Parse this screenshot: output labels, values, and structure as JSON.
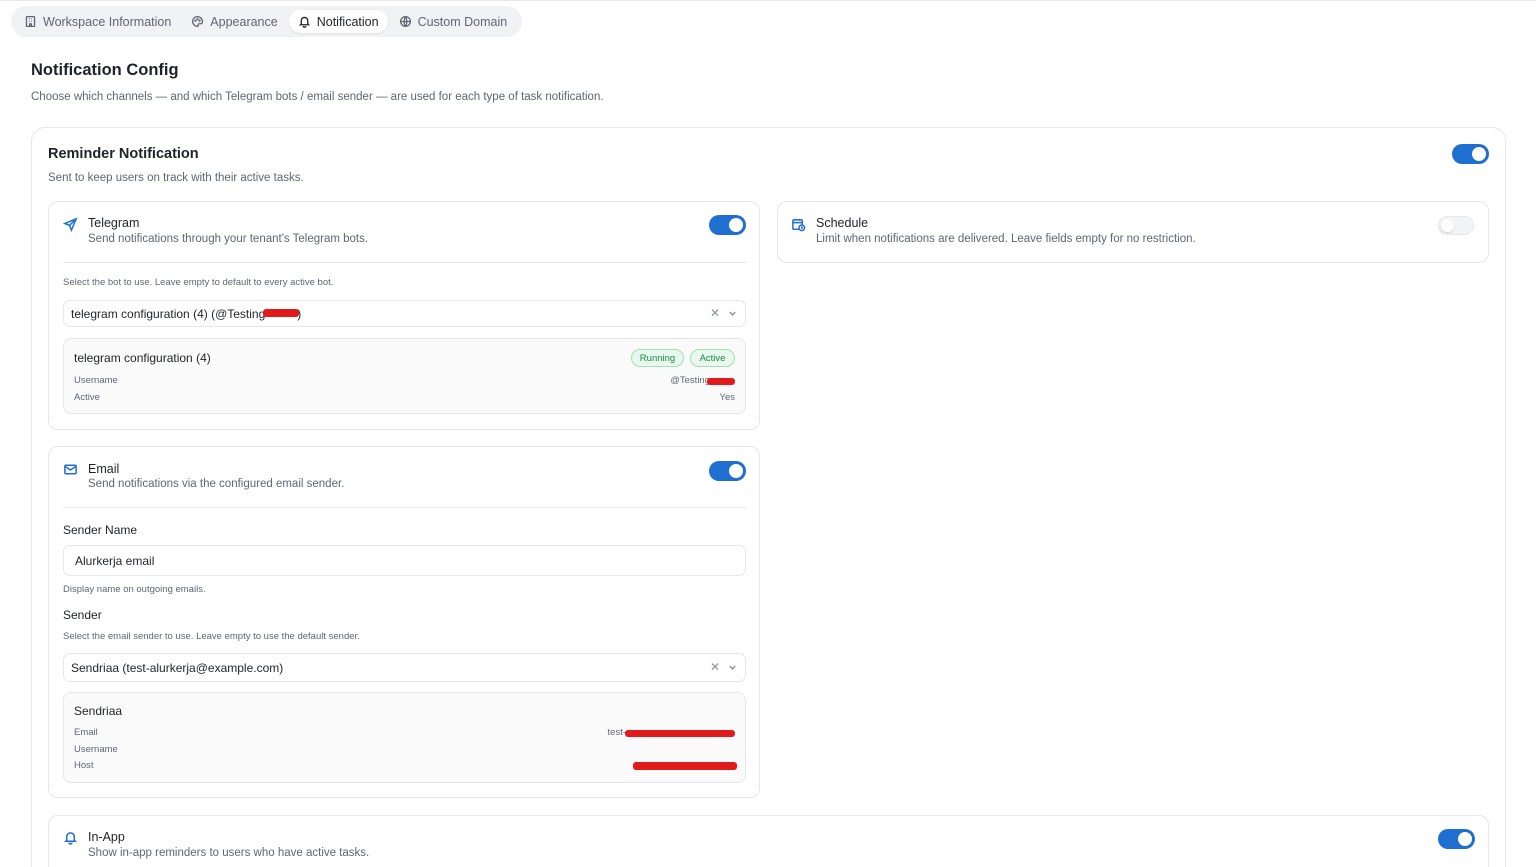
{
  "tabs": [
    {
      "label": "Workspace Information",
      "icon": "building-icon"
    },
    {
      "label": "Appearance",
      "icon": "palette-icon"
    },
    {
      "label": "Notification",
      "icon": "bell-icon",
      "active": true
    },
    {
      "label": "Custom Domain",
      "icon": "globe-icon"
    }
  ],
  "page": {
    "title": "Notification Config",
    "description": "Choose which channels — and which Telegram bots / email sender — are used for each type of task notification."
  },
  "reminder": {
    "title": "Reminder Notification",
    "description": "Sent to keep users on track with their active tasks.",
    "enabled": true
  },
  "telegram": {
    "title": "Telegram",
    "description": "Send notifications through your tenant's Telegram bots.",
    "enabled": true,
    "hint": "Select the bot to use. Leave empty to default to every active bot.",
    "selected": "telegram configuration (4) (@Testing",
    "selected_suffix": ")",
    "bot": {
      "name": "telegram configuration (4)",
      "badges": [
        "Running",
        "Active"
      ],
      "username_label": "Username",
      "username_value": "@Testing",
      "active_label": "Active",
      "active_value": "Yes"
    }
  },
  "schedule": {
    "title": "Schedule",
    "description": "Limit when notifications are delivered. Leave fields empty for no restriction.",
    "enabled": false
  },
  "email": {
    "title": "Email",
    "description": "Send notifications via the configured email sender.",
    "enabled": true,
    "sender_name_label": "Sender Name",
    "sender_name_value": "Alurkerja email",
    "sender_name_hint": "Display name on outgoing emails.",
    "sender_label": "Sender",
    "sender_hint": "Select the email sender to use. Leave empty to use the default sender.",
    "sender_selected": "Sendriaa (test-alurkerja@example.com)",
    "sender_info": {
      "name": "Sendriaa",
      "email_label": "Email",
      "email_value": "test-",
      "username_label": "Username",
      "host_label": "Host"
    }
  },
  "inapp": {
    "title": "In-App",
    "description": "Show in-app reminders to users who have active tasks.",
    "enabled": true
  },
  "colors": {
    "accent": "#1f6fd1",
    "badge_green": "#1b8a45",
    "redaction": "#e01b1b"
  }
}
